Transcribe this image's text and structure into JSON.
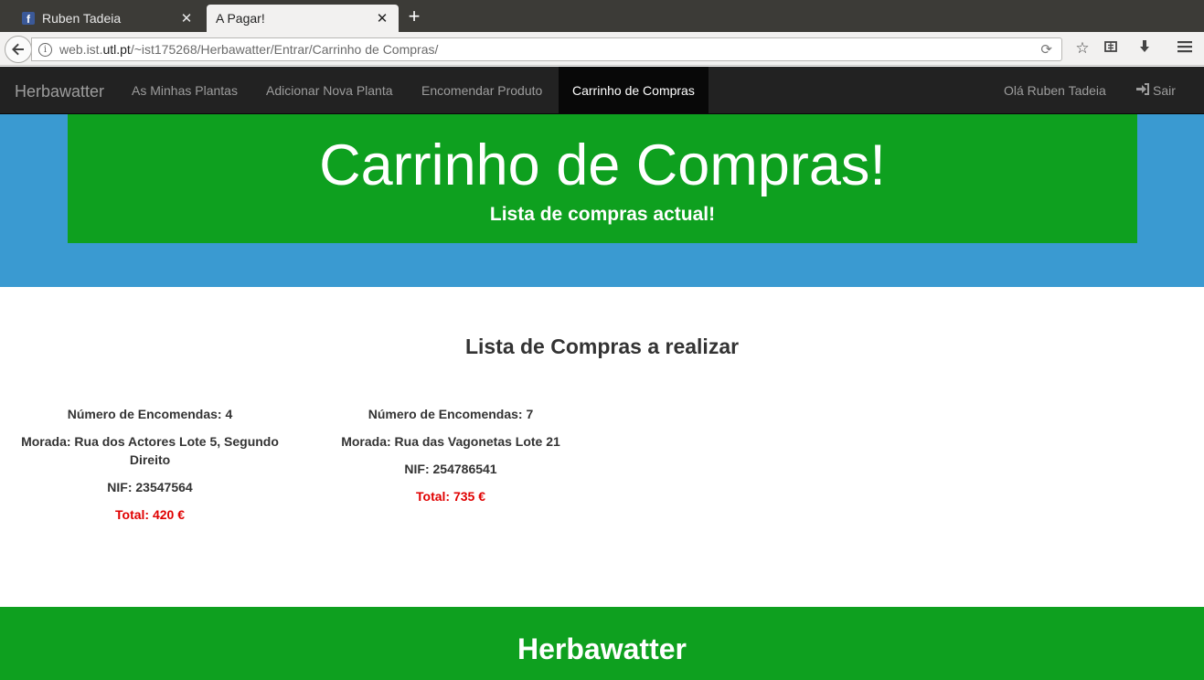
{
  "browser": {
    "tabs": [
      {
        "title": "Ruben Tadeia",
        "favicon": "facebook-icon",
        "active": false
      },
      {
        "title": "A Pagar!",
        "active": true
      }
    ],
    "url": {
      "prefix": "web.ist.",
      "domain": "utl.pt",
      "path": "/~ist175268/Herbawatter/Entrar/Carrinho de Compras/"
    }
  },
  "navbar": {
    "brand": "Herbawatter",
    "items": [
      {
        "label": "As Minhas Plantas",
        "active": false
      },
      {
        "label": "Adicionar Nova Planta",
        "active": false
      },
      {
        "label": "Encomendar Produto",
        "active": false
      },
      {
        "label": "Carrinho de Compras",
        "active": true
      }
    ],
    "user": "Olá Ruben Tadeia",
    "logout": "Sair"
  },
  "hero": {
    "title": "Carrinho de Compras!",
    "subtitle": "Lista de compras actual!"
  },
  "main": {
    "section_title": "Lista de Compras a realizar",
    "orders": [
      {
        "encomendas": "Número de Encomendas: 4",
        "morada": "Morada: Rua dos Actores Lote 5, Segundo Direito",
        "nif": "NIF: 23547564",
        "total": "Total: 420 €"
      },
      {
        "encomendas": "Número de Encomendas: 7",
        "morada": "Morada: Rua das Vagonetas Lote 21",
        "nif": "NIF: 254786541",
        "total": "Total: 735 €"
      }
    ]
  },
  "footer": {
    "title": "Herbawatter"
  },
  "colors": {
    "hero_green": "#0ea01f",
    "hero_blue": "#3a9ad1",
    "nav_dark": "#222222",
    "total_red": "#e00000"
  }
}
